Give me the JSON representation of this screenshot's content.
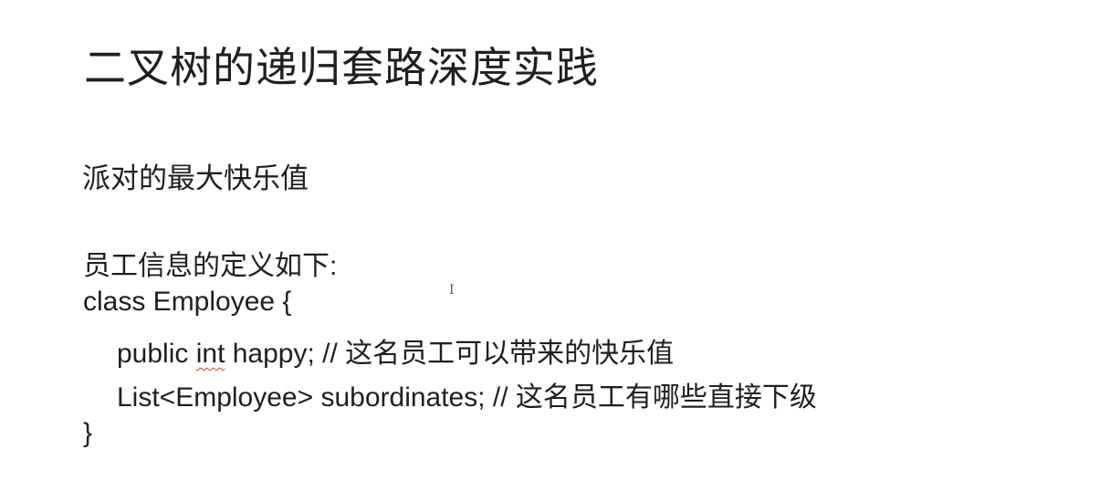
{
  "slide": {
    "title": "二叉树的递归套路深度实践",
    "subtitle": "派对的最大快乐值",
    "intro": "员工信息的定义如下:",
    "code": {
      "class_open": "class Employee {",
      "line_happy_before": "public ",
      "line_happy_type": "int",
      "line_happy_after": " happy; // 这名员工可以带来的快乐值",
      "line_subordinates": "List<Employee> subordinates; // 这名员工有哪些直接下级",
      "class_close": "}"
    }
  },
  "cursor": {
    "icon": "text-cursor-icon",
    "glyph": "I"
  }
}
